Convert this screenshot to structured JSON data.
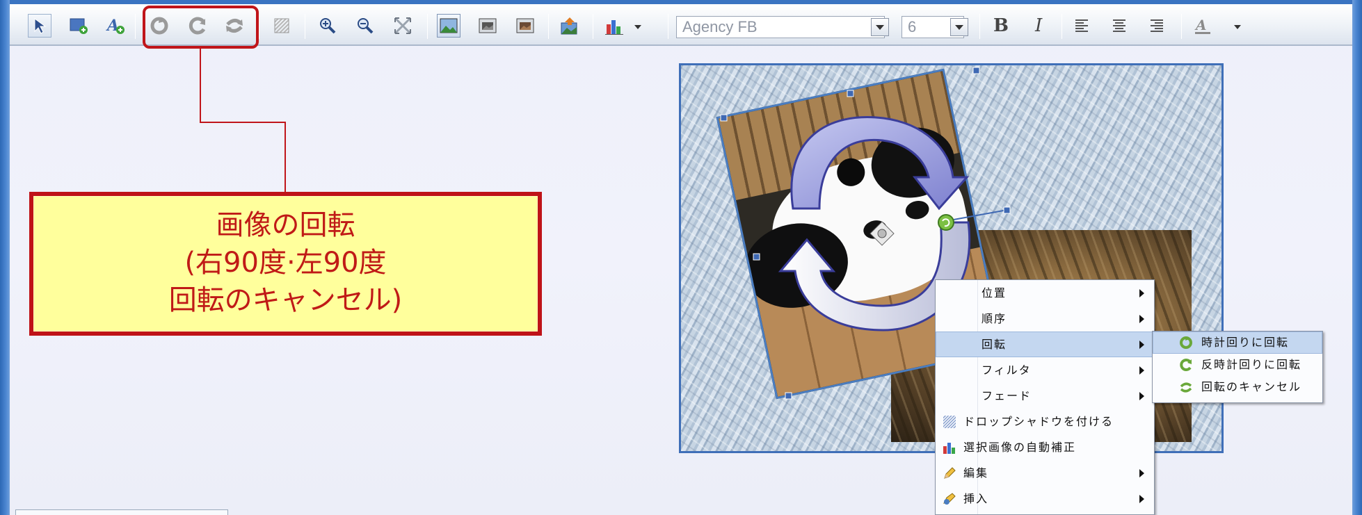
{
  "toolbar": {
    "font_name": "Agency FB",
    "font_size": "6",
    "bold_label": "B",
    "italic_label": "I",
    "icons": [
      "select-pointer-icon",
      "insert-image-icon",
      "insert-text-icon",
      "rotate-clockwise-icon",
      "rotate-counterclockwise-icon",
      "cancel-rotation-icon",
      "drop-shadow-icon",
      "zoom-in-icon",
      "zoom-out-icon",
      "fit-icon",
      "background-image-icon",
      "image-small-icon",
      "image-large-icon",
      "import-image-icon",
      "auto-correct-icon",
      "align-left-icon",
      "align-center-icon",
      "align-right-icon",
      "text-color-icon"
    ]
  },
  "callout": {
    "line1": "画像の回転",
    "line2": "(右90度·左90度",
    "line3": "回転のキャンセル)"
  },
  "context_menu": {
    "items": [
      {
        "label": "位置",
        "submenu": true
      },
      {
        "label": "順序",
        "submenu": true
      },
      {
        "label": "回転",
        "submenu": true,
        "highlighted": true
      },
      {
        "label": "フィルタ",
        "submenu": true
      },
      {
        "label": "フェード",
        "submenu": true
      },
      {
        "label": "ドロップシャドウを付ける",
        "submenu": false,
        "icon": "drop-shadow-icon"
      },
      {
        "label": "選択画像の自動補正",
        "submenu": false,
        "icon": "auto-correct-icon"
      },
      {
        "label": "編集",
        "submenu": true,
        "icon": "pencil-icon"
      },
      {
        "label": "挿入",
        "submenu": true,
        "icon": "insert-icon"
      }
    ]
  },
  "rotate_submenu": {
    "items": [
      {
        "label": "時計回りに回転",
        "icon": "rotate-clockwise-icon",
        "highlighted": true
      },
      {
        "label": "反時計回りに回転",
        "icon": "rotate-counterclockwise-icon"
      },
      {
        "label": "回転のキャンセル",
        "icon": "cancel-rotation-icon"
      }
    ]
  },
  "colors": {
    "callout_border": "#bf1318",
    "callout_fill": "#ffff9c",
    "callout_text": "#c01a17",
    "highlight": "#c4d7f0"
  }
}
